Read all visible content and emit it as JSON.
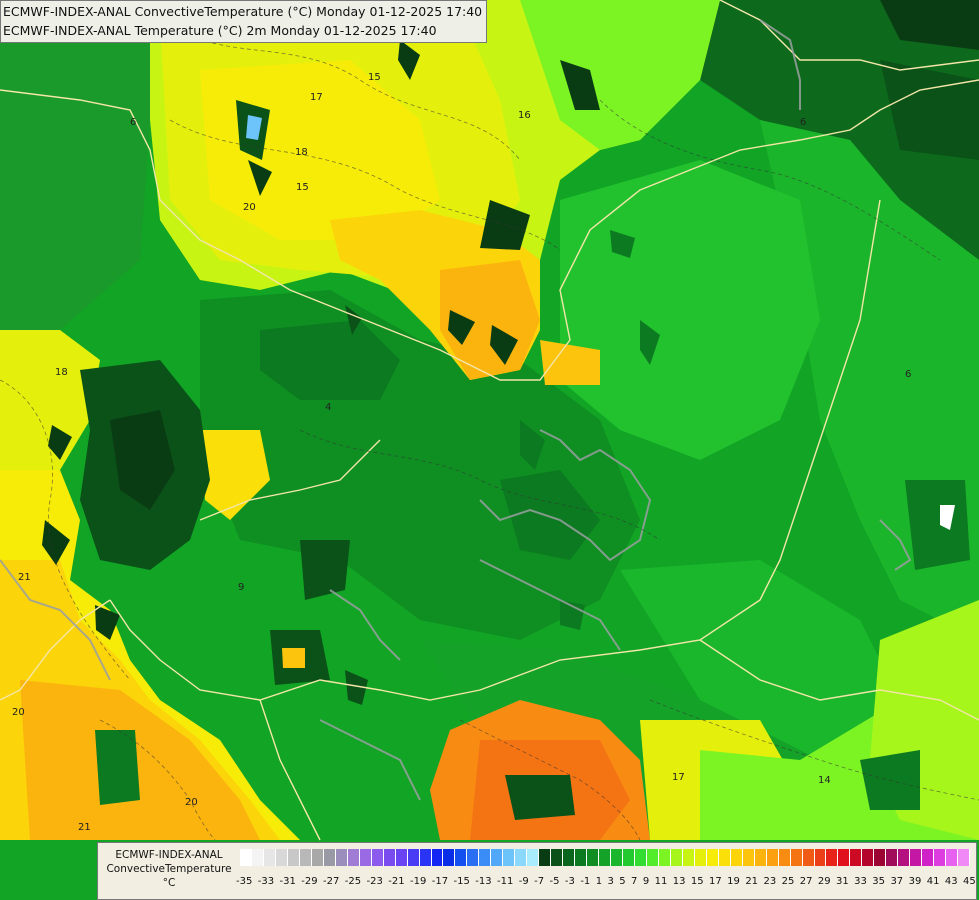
{
  "header": {
    "line1": "ECMWF-INDEX-ANAL ConvectiveTemperature (°C) Monday 01-12-2025 17:40",
    "line2": "ECMWF-INDEX-ANAL Temperature (°C) 2m Monday 01-12-2025 17:40"
  },
  "legend": {
    "title_line1": "ECMWF-INDEX-ANAL",
    "title_line2": "ConvectiveTemperature",
    "unit": "°C",
    "ticks": [
      "-35",
      "-33",
      "-31",
      "-29",
      "-27",
      "-25",
      "-23",
      "-21",
      "-19",
      "-17",
      "-15",
      "-13",
      "-11",
      "-9",
      "-7",
      "-5",
      "-3",
      "-1",
      "1",
      "3",
      "5",
      "7",
      "9",
      "11",
      "13",
      "15",
      "17",
      "19",
      "21",
      "23",
      "25",
      "27",
      "29",
      "31",
      "33",
      "35",
      "37",
      "39",
      "41",
      "43",
      "45"
    ],
    "colors": [
      "#ffffff",
      "#f4f4f4",
      "#e6e6e6",
      "#d8d8d8",
      "#c8c8c8",
      "#b8b8b8",
      "#a8a8a8",
      "#9a9aa6",
      "#9c8ebc",
      "#a07cd4",
      "#9a6ae4",
      "#8c5aec",
      "#7a4cf0",
      "#6a44f2",
      "#4a3cf4",
      "#2a34f6",
      "#1426f4",
      "#0a2ee8",
      "#1450f0",
      "#2a6ef4",
      "#3a8cf6",
      "#52a8f8",
      "#6cc4fa",
      "#8ad8fc",
      "#a8ecfe",
      "#0a3c14",
      "#0a5218",
      "#0a661c",
      "#0c7a20",
      "#108e24",
      "#14a228",
      "#1ab62c",
      "#22ca30",
      "#32dc30",
      "#52ec2a",
      "#7cf424",
      "#a6f61c",
      "#c8f414",
      "#e4f00c",
      "#f6ec08",
      "#fae008",
      "#fcd40a",
      "#fcc40c",
      "#fbb40e",
      "#fba010",
      "#f88c12",
      "#f47414",
      "#f05c16",
      "#ec4018",
      "#e8241a",
      "#e0101c",
      "#cc0a24",
      "#b4062c",
      "#9c0434",
      "#a00c5a",
      "#b41080",
      "#c418a4",
      "#d020c8",
      "#dc3ce0",
      "#e860f0",
      "#f088f6"
    ]
  },
  "contour_labels": [
    "15",
    "17",
    "18",
    "16",
    "20",
    "15",
    "6",
    "18",
    "4",
    "21",
    "20",
    "20",
    "17",
    "14",
    "6",
    "9",
    "6",
    "21"
  ]
}
